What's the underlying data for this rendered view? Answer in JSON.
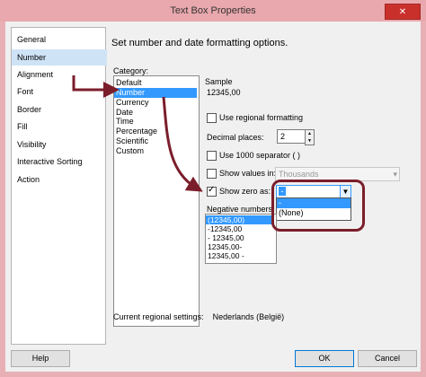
{
  "window": {
    "title": "Text Box Properties",
    "close_glyph": "✕"
  },
  "nav": {
    "items": [
      {
        "label": "General",
        "selected": false
      },
      {
        "label": "Number",
        "selected": true
      },
      {
        "label": "Alignment",
        "selected": false
      },
      {
        "label": "Font",
        "selected": false
      },
      {
        "label": "Border",
        "selected": false
      },
      {
        "label": "Fill",
        "selected": false
      },
      {
        "label": "Visibility",
        "selected": false
      },
      {
        "label": "Interactive Sorting",
        "selected": false
      },
      {
        "label": "Action",
        "selected": false
      }
    ]
  },
  "heading": "Set number and date formatting options.",
  "category": {
    "label": "Category:",
    "items": [
      {
        "label": "Default",
        "selected": false
      },
      {
        "label": "Number",
        "selected": true
      },
      {
        "label": "Currency",
        "selected": false
      },
      {
        "label": "Date",
        "selected": false
      },
      {
        "label": "Time",
        "selected": false
      },
      {
        "label": "Percentage",
        "selected": false
      },
      {
        "label": "Scientific",
        "selected": false
      },
      {
        "label": "Custom",
        "selected": false
      }
    ]
  },
  "sample": {
    "label": "Sample",
    "value": "12345,00"
  },
  "options": {
    "use_regional": {
      "label": "Use regional formatting",
      "checked": false
    },
    "decimal_places": {
      "label": "Decimal places:",
      "value": "2"
    },
    "use_1000": {
      "label": "Use 1000 separator ( )",
      "checked": false
    },
    "show_values_in": {
      "label": "Show values in:",
      "checked": false,
      "value": "Thousands"
    },
    "show_zero": {
      "label": "Show zero as:",
      "checked": true,
      "value": "-"
    }
  },
  "zero_dropdown": {
    "options": [
      "-",
      "(None)"
    ],
    "highlighted": 0
  },
  "negative": {
    "label": "Negative numbers:",
    "items": [
      {
        "label": "(12345,00)",
        "selected": true
      },
      {
        "label": "-12345,00",
        "selected": false
      },
      {
        "label": "- 12345,00",
        "selected": false
      },
      {
        "label": "12345,00-",
        "selected": false
      },
      {
        "label": "12345,00 -",
        "selected": false
      }
    ]
  },
  "regional": {
    "label": "Current regional settings:",
    "value": "Nederlands (België)"
  },
  "buttons": {
    "help": "Help",
    "ok": "OK",
    "cancel": "Cancel"
  },
  "colors": {
    "selection": "#3399ff",
    "annotation": "#7b1e2b",
    "nav_selected": "#cfe3f6"
  }
}
